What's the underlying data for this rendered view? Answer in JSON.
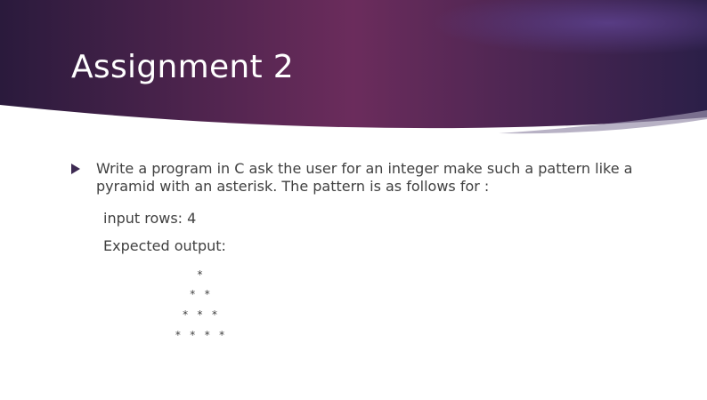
{
  "slide": {
    "title": "Assignment 2",
    "bullet_text": "Write a program in C ask the user for an integer make such a pattern like a pyramid with an asterisk. The pattern is as follows for :",
    "input_label": "input rows: 4",
    "expected_label": "Expected output:",
    "pattern": [
      "*",
      "* *",
      "* * *",
      "* * * *"
    ]
  },
  "colors": {
    "header_dark": "#2e1b3f",
    "header_mid": "#6b2c5c",
    "accent_bullet": "#3d2a52",
    "text": "#404040"
  }
}
